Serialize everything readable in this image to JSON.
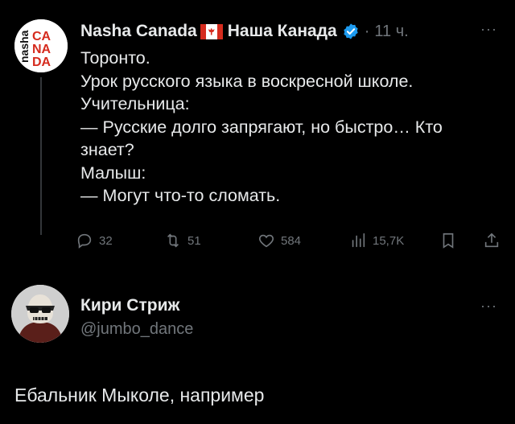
{
  "tweet": {
    "author_name": "Nasha Canada",
    "author_name_ru": "Наша Канада",
    "avatar_text": [
      "nasha",
      "CA",
      "NA",
      "DA"
    ],
    "separator": "·",
    "time": "11 ч.",
    "more": "···",
    "lines": [
      "Торонто.",
      "Урок русского языка в воскресной школе.",
      "Учительница:",
      "— Русские долго запрягают, но быстро… Кто",
      "знает?",
      "Малыш:",
      "— Могут что-то сломать."
    ],
    "actions": {
      "replies": "32",
      "reposts": "51",
      "likes": "584",
      "views": "15,7K"
    }
  },
  "reply": {
    "author_name": "Кири Стриж",
    "handle": "@jumbo_dance",
    "more": "···",
    "text": "Ебальник Мыколе, например"
  },
  "colors": {
    "background": "#000000",
    "text": "#e7e9ea",
    "muted": "#71767b",
    "verified": "#1d9bf0",
    "canada_red": "#d52b1e"
  }
}
